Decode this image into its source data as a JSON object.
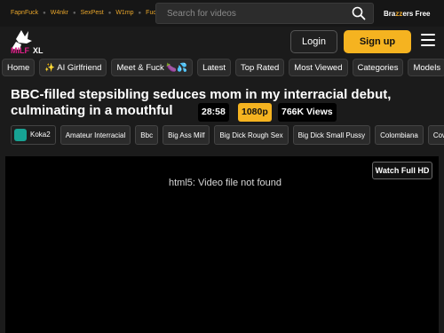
{
  "partner_sites": [
    "FapnFuck",
    "W4nkr",
    "SexPest",
    "W1mp",
    "Fuqster"
  ],
  "search": {
    "placeholder": "Search for videos"
  },
  "brazzers_promo": {
    "brand": "Brazzers",
    "suffix": " Free",
    "highlight": "zz"
  },
  "header": {
    "logo_text": "MILF XL",
    "login_label": "Login",
    "signup_label": "Sign up"
  },
  "nav": [
    "Home",
    "✨ AI Girlfriend",
    "Meet & Fuck 🍆💦",
    "Latest",
    "Top Rated",
    "Most Viewed",
    "Categories",
    "Models"
  ],
  "video": {
    "title": "BBC-filled stepsibling seduces mom in my interracial debut, culminating in a mouthful",
    "duration": "28:58",
    "quality": "1080p",
    "views": "766K Views",
    "uploader": "Koka2",
    "tags": [
      "Amateur Interracial",
      "Bbc",
      "Big Ass Milf",
      "Big Dick Rough Sex",
      "Big Dick Small Pussy",
      "Colombiana",
      "Cow"
    ]
  },
  "player": {
    "watch_full_label": "Watch Full HD",
    "error_text": "html5: Video file not found"
  },
  "colors": {
    "accent": "#f5b320",
    "uploader_icon": "#17a394",
    "background": "#1b1b1b"
  }
}
